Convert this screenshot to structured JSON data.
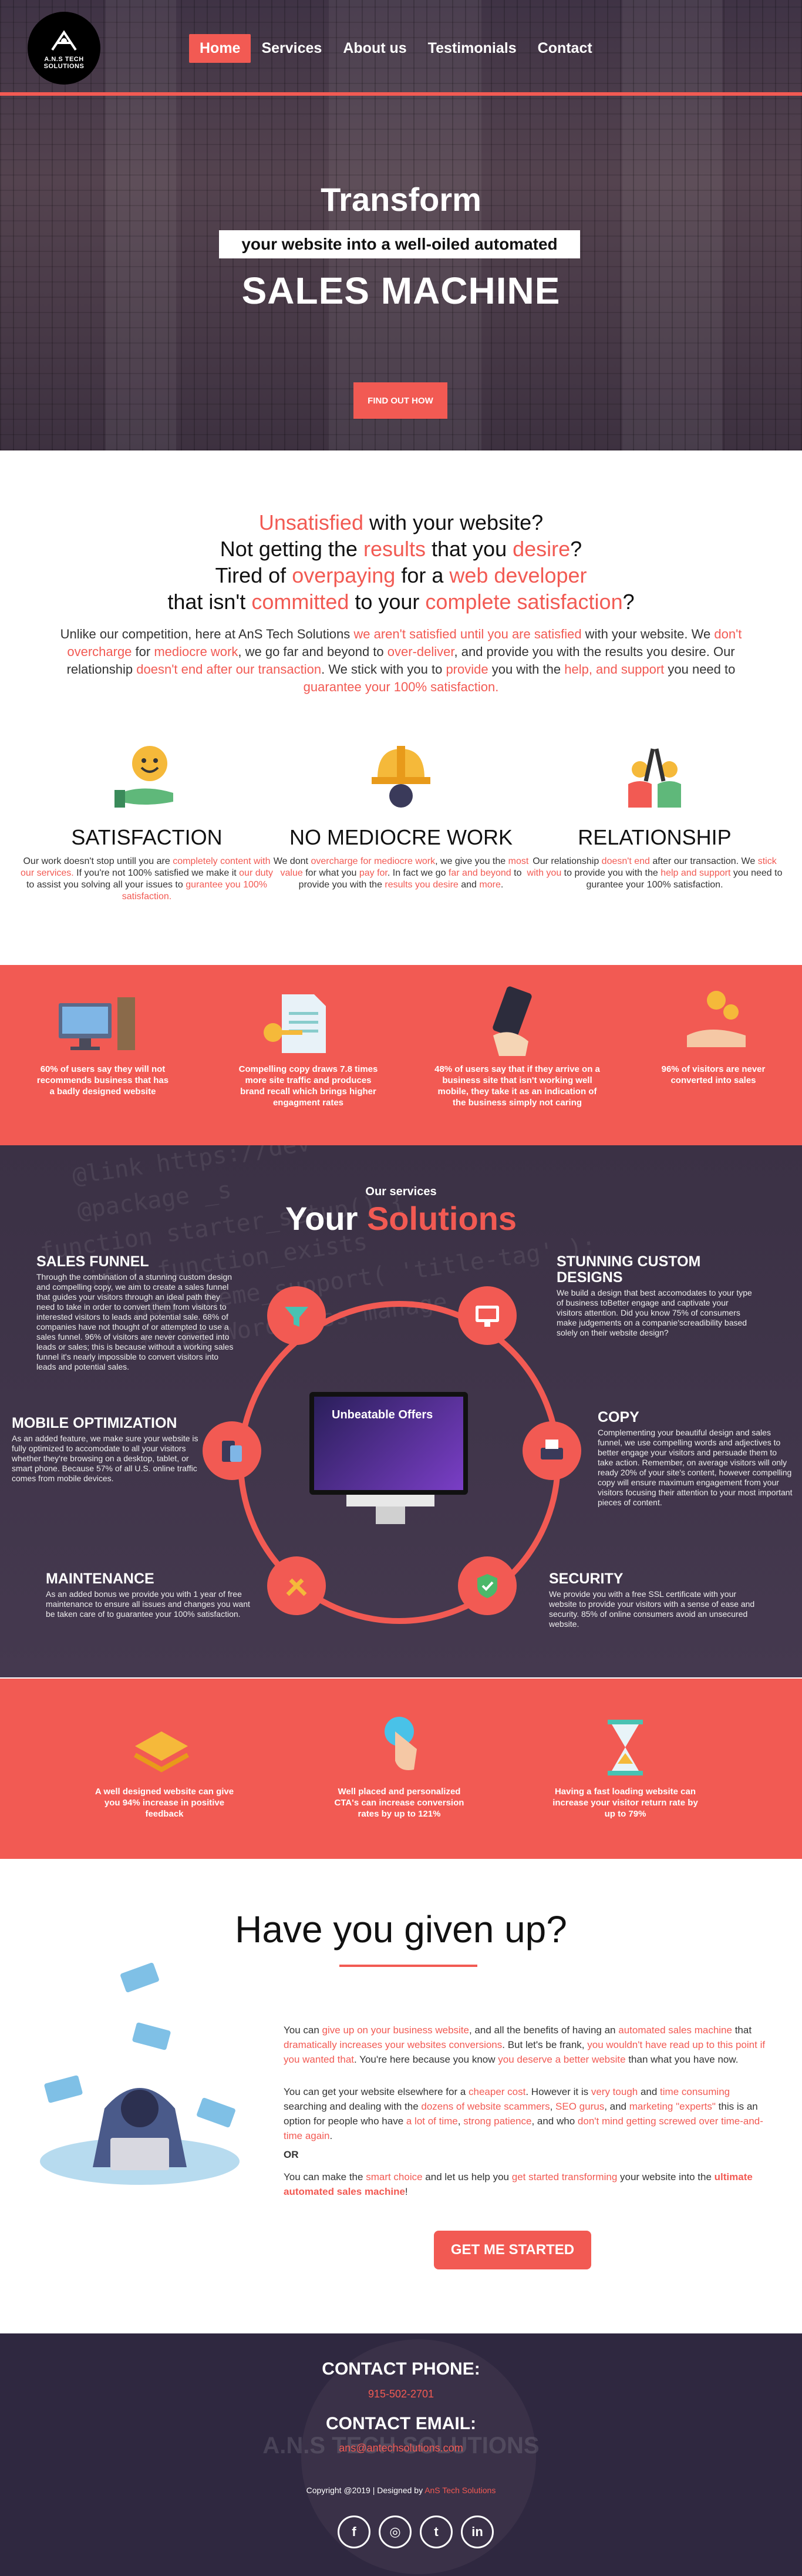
{
  "header": {
    "logo_text": "A.N.S TECH SOLUTIONS",
    "nav": [
      "Home",
      "Services",
      "About us",
      "Testimonials",
      "Contact"
    ]
  },
  "hero": {
    "title": "Transform",
    "subtitle": "your website into a well-oiled automated",
    "big": "SALES MACHINE",
    "button": "FIND OUT HOW"
  },
  "intro": {
    "q1_a": "Unsatisfied",
    "q1_b": " with your website?",
    "q2_a": "Not getting the ",
    "q2_b": "results",
    "q2_c": " that you ",
    "q2_d": "desire",
    "q2_e": "?",
    "q3_a": "Tired of ",
    "q3_b": "overpaying",
    "q3_c": " for a ",
    "q3_d": "web developer",
    "q4_a": "that isn't ",
    "q4_b": "committed",
    "q4_c": " to your ",
    "q4_d": "complete satisfaction",
    "q4_e": "?",
    "p_1": "Unlike our competition, here at AnS Tech Solutions ",
    "p_2": "we aren't satisfied until you are satisfied",
    "p_3": " with your website. We ",
    "p_4": "don't overcharge",
    "p_5": " for ",
    "p_6": "mediocre work",
    "p_7": ", we go far and beyond to ",
    "p_8": "over-deliver",
    "p_9": ", and provide you with the results you desire. Our relationship ",
    "p_10": "doesn't end after our transaction",
    "p_11": ". We stick with you to ",
    "p_12": "provide",
    "p_13": " you with the ",
    "p_14": "help, and support",
    "p_15": " you need to ",
    "p_16": "guarantee your 100% satisfaction."
  },
  "features": [
    {
      "title": "SATISFACTION",
      "t1": "Our work doesn't stop untill you are ",
      "t2": "completely content with our services.",
      "t3": " If you're not 100% satisfied we make it ",
      "t4": "our duty",
      "t5": " to assist you solving all your issues to ",
      "t6": "gurantee you 100% satisfaction."
    },
    {
      "title": "NO MEDIOCRE WORK",
      "t1": "We dont ",
      "t2": "overcharge for mediocre work",
      "t3": ", we give you the ",
      "t4": "most value",
      "t5": " for what you ",
      "t6": "pay for",
      "t7": ". In fact we go ",
      "t8": "far and beyond",
      "t9": " to provide you with the ",
      "t10": "results you desire",
      "t11": " and ",
      "t12": "more",
      "t13": "."
    },
    {
      "title": "RELATIONSHIP",
      "t1": "Our relationship ",
      "t2": "doesn't end",
      "t3": " after our transaction. We ",
      "t4": "stick with you",
      "t5": " to provide you with the ",
      "t6": "help and support",
      "t7": " you need to gurantee your 100% satisfaction."
    }
  ],
  "stats1": [
    "60% of users say they will not recommends business that has a badly designed website",
    "Compelling copy draws 7.8 times more site traffic and produces brand recall which brings higher engagment rates",
    "48% of users say that if they arrive on a business site that isn't working well mobile, they take it as an indication of the business simply not caring",
    "96% of visitors are never converted into sales"
  ],
  "solutions": {
    "small": "Our services",
    "big_a": "Your ",
    "big_b": "Solutions",
    "screen_text": "Unbeatable Offers",
    "items": [
      {
        "title": "SALES FUNNEL",
        "text": "Through the combination of a stunning custom design and compelling copy, we aim to create a sales funnel that guides your visitors through an ideal path they need to take in order to convert them from visitors to interested visitors to leads and potential sale. 68% of companies have not thought of or attempted to use a sales funnel. 96% of visitors are never converted into leads or sales; this is because without a working sales funnel it's nearly impossible to convert visitors into leads and potential sales."
      },
      {
        "title": "STUNNING CUSTOM DESIGNS",
        "text": "We build a design that best accomodates to your type of business toBetter engage and captivate your visitors attention. Did you know 75% of consumers make judgements on a companie'screadibility based solely on their website design?"
      },
      {
        "title": "MOBILE OPTIMIZATION",
        "text": "As an added feature, we make sure your website is fully optimized to accomodate to all your visitors whether they're browsing on a desktop, tablet, or smart phone. Because 57% of all U.S. online traffic comes from mobile devices."
      },
      {
        "title": "COPY",
        "text": "Complementing your beautiful design and sales funnel, we use compelling words and adjectives to better engage your visitors and persuade them to take action. Remember, on average visitors will only ready 20% of your site's content, however compelling copy will ensure maximum engagement from your visitors focusing their attention to your most important pieces of content."
      },
      {
        "title": "MAINTENANCE",
        "text": "As an added bonus we provide you with 1 year of free maintenance to ensure all issues and changes you want be taken care of to guarantee your 100% satisfaction."
      },
      {
        "title": "SECURITY",
        "text": "We provide you with a free SSL certificate with your website to provide your visitors with a sense of ease and security. 85% of online consumers avoid an unsecured website."
      }
    ]
  },
  "stats2": [
    "A well designed website can give you 94% increase in positive feedback",
    "Well placed and personalized CTA's can increase conversion rates by up to 121%",
    "Having a fast loading website can increase your visitor return rate by up to 79%"
  ],
  "given_up": {
    "title": "Have you given up?",
    "p1_1": "You can ",
    "p1_2": "give up on your business website",
    "p1_3": ", and all the benefits of having an ",
    "p1_4": "automated sales machine",
    "p1_5": " that ",
    "p1_6": "dramatically increases your websites conversions",
    "p1_7": ". But let's be frank, ",
    "p1_8": "you wouldn't have read up to this point if you wanted that",
    "p1_9": ". You're here because you know ",
    "p1_10": "you deserve a better website",
    "p1_11": " than what you have now.",
    "p2_1": "You can get your website elsewhere for a ",
    "p2_2": "cheaper cost",
    "p2_3": ". However it is ",
    "p2_4": "very tough",
    "p2_5": " and ",
    "p2_6": "time consuming",
    "p2_7": " searching and dealing with the ",
    "p2_8": "dozens of website scammers",
    "p2_9": ", ",
    "p2_10": "SEO gurus",
    "p2_11": ", and ",
    "p2_12": "marketing \"experts\"",
    "p2_13": " this is an option for people who have ",
    "p2_14": "a lot of time",
    "p2_15": ", ",
    "p2_16": "strong patience",
    "p2_17": ", and who ",
    "p2_18": "don't mind getting screwed over time-and-time again",
    "p2_19": ".",
    "or": "OR",
    "p3_1": "You can make the ",
    "p3_2": "smart choice",
    "p3_3": " and let us help you ",
    "p3_4": "get started transforming",
    "p3_5": " your website into the ",
    "p3_6": "ultimate automated sales machine",
    "p3_7": "!",
    "button": "GET ME STARTED"
  },
  "footer": {
    "phone_label": "CONTACT PHONE:",
    "phone": "915-502-2701",
    "email_label": "CONTACT EMAIL:",
    "email": "ans@antechsolutions.com",
    "watermark": "A.N.S TECH SOLUTIONS",
    "copy_1": "Copyright @2019 | Designed by ",
    "copy_2": "AnS Tech Solutions",
    "social": [
      "f",
      "◎",
      "t",
      "in"
    ]
  },
  "colors": {
    "accent": "#f25a53",
    "dark": "#3b3145"
  }
}
